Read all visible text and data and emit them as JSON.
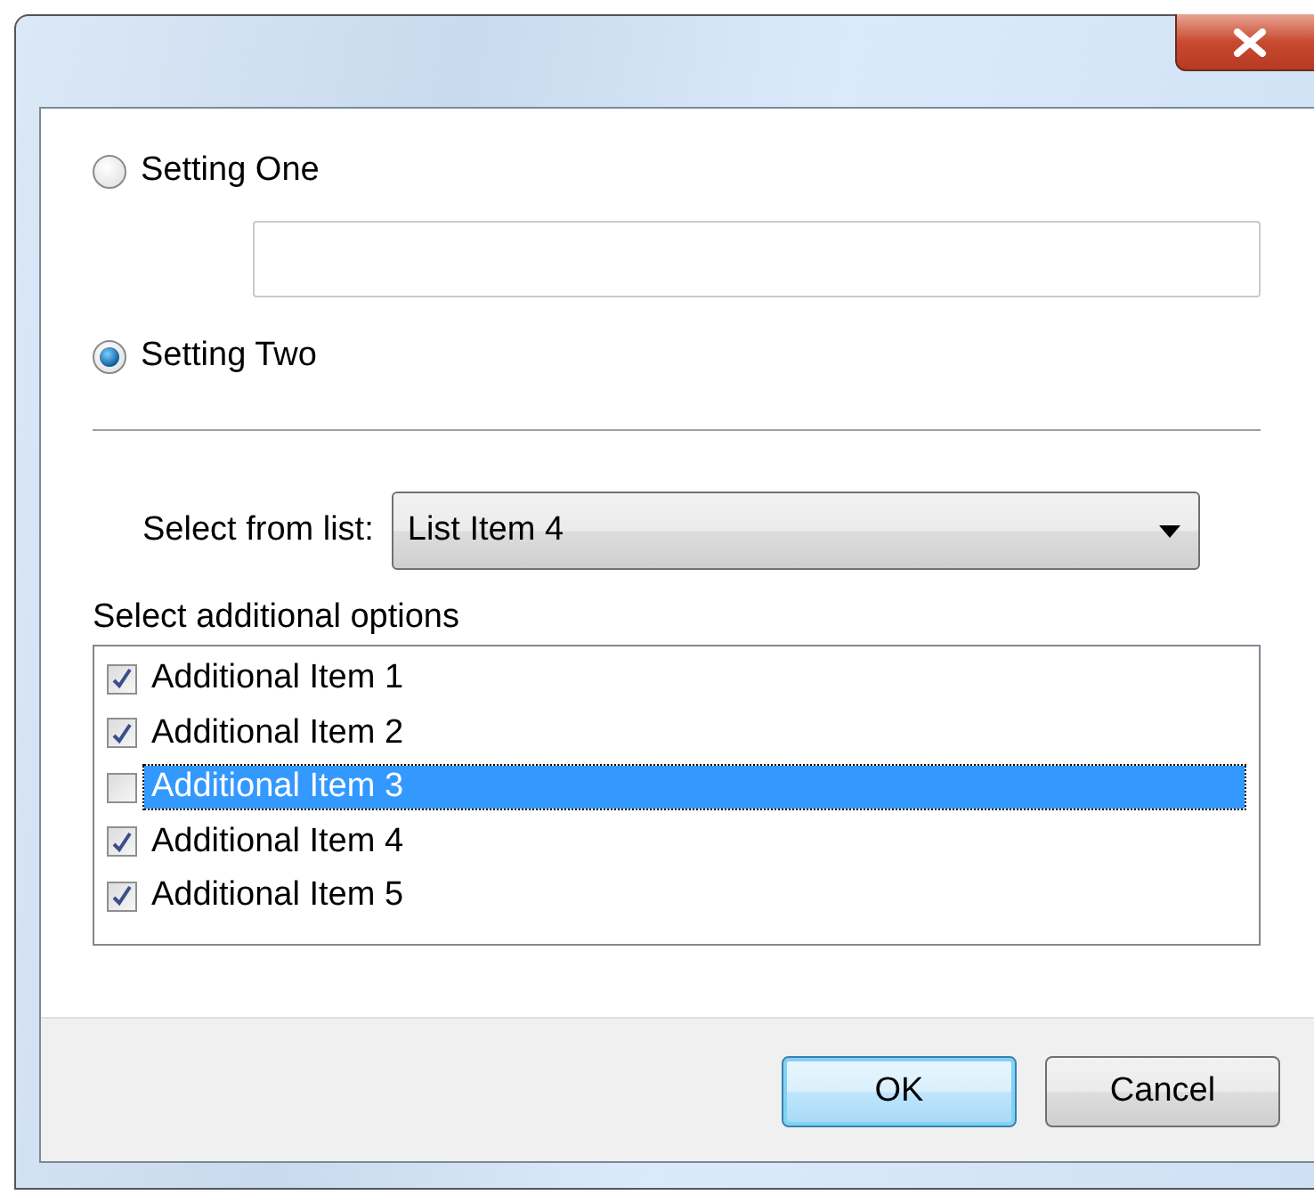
{
  "settings": [
    {
      "label": "Setting One",
      "selected": false,
      "kind": "with_field"
    },
    {
      "label": "Setting Two",
      "selected": true,
      "kind": "plain"
    }
  ],
  "list_select": {
    "label": "Select from list:",
    "value": "List Item 4"
  },
  "options": {
    "label": "Select additional options",
    "items": [
      {
        "label": "Additional Item 1",
        "checked": true,
        "selected": false
      },
      {
        "label": "Additional Item 2",
        "checked": true,
        "selected": false
      },
      {
        "label": "Additional Item 3",
        "checked": false,
        "selected": true
      },
      {
        "label": "Additional Item 4",
        "checked": true,
        "selected": false
      },
      {
        "label": "Additional Item 5",
        "checked": true,
        "selected": false
      }
    ]
  },
  "buttons": [
    {
      "label": "OK",
      "kind": "default"
    },
    {
      "label": "Cancel",
      "kind": "normal"
    }
  ]
}
